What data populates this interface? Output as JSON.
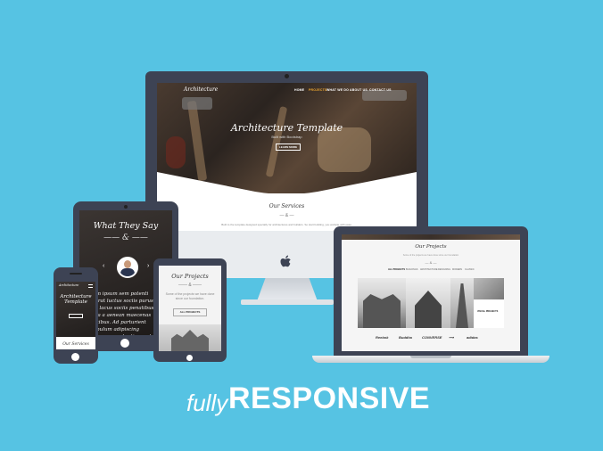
{
  "headline": {
    "prefix": "fully",
    "main": "RESPONSIVE"
  },
  "imac": {
    "logo": "Architecture",
    "nav": [
      "HOME",
      "PROJECTS",
      "WHAT WE DO",
      "ABOUT US",
      "CONTACT US"
    ],
    "hero_title": "Architecture Template",
    "hero_subtitle": "Built with Bootstrap",
    "hero_button": "LEARN MORE",
    "services_title": "Our Services",
    "services_desc": "Built to the template designed specially for architectures and builders. So start building, you website with ease.",
    "accent_color": "#f0a830"
  },
  "laptop": {
    "title": "Our Projects",
    "subtitle": "Some of the projects we have done since our foundation",
    "filters": [
      "ALL PROJECTS",
      "BUILDINGS",
      "ARCHITECTURE",
      "DESIGNING",
      "MODERN",
      "CLASSIC"
    ],
    "feature_label": "VISUAL PROJECTS",
    "logos": [
      "Reebok",
      "Buddha",
      "CONVERSE",
      "",
      "adidas"
    ]
  },
  "tablet_large": {
    "title": "What They Say",
    "quote": "Lorem ipsum sem potenti placerat luctus sociis purus sit proin lacus sociis penatibus nostra a aenean maecenas penatibus. Ad parturient vestibulum adipiscing ullamcorper potenti a eget amet a porta."
  },
  "phone": {
    "logo": "Architecture",
    "title": "Architecture Template",
    "services": "Our Services"
  },
  "tablet_small": {
    "title": "Our Projects",
    "desc": "Some of the projects we have done since our foundation.",
    "button": "ALL PROJECTS"
  }
}
